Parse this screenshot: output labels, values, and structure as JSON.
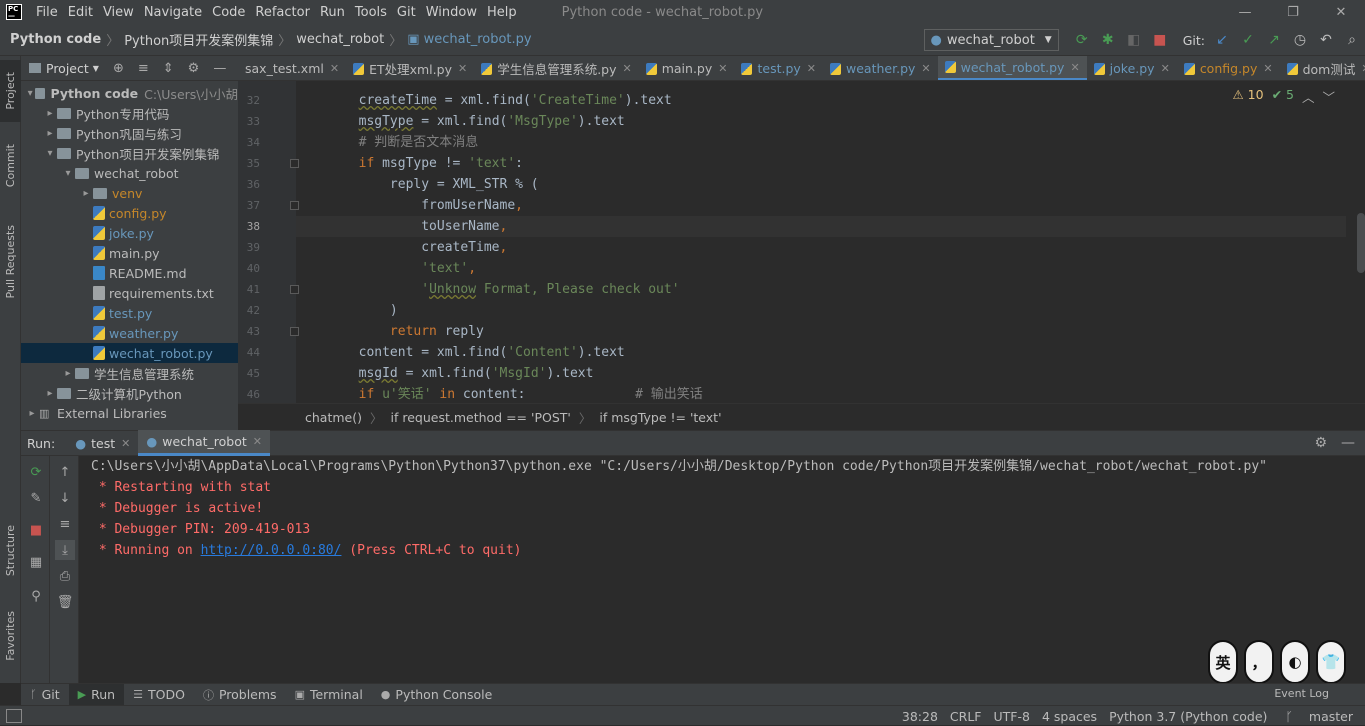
{
  "titlebar": {
    "menu": [
      "File",
      "Edit",
      "View",
      "Navigate",
      "Code",
      "Refactor",
      "Run",
      "Tools",
      "Git",
      "Window",
      "Help"
    ],
    "title": "Python code - wechat_robot.py"
  },
  "navbar": {
    "crumbs": [
      "Python code",
      "Python项目开发案例集锦",
      "wechat_robot",
      "wechat_robot.py"
    ],
    "run_config": "wechat_robot",
    "git_label": "Git:"
  },
  "sidebar_tabs": {
    "project": "Project",
    "commit": "Commit",
    "pull_requests": "Pull Requests",
    "structure": "Structure",
    "favorites": "Favorites"
  },
  "project_panel": {
    "title": "Project",
    "tree": [
      {
        "label": "Python code",
        "extra": "C:\\Users\\小小胡",
        "depth": 0,
        "type": "folder",
        "open": true,
        "bold": true
      },
      {
        "label": "Python专用代码",
        "depth": 1,
        "type": "folder",
        "open": false
      },
      {
        "label": "Python巩固与练习",
        "depth": 1,
        "type": "folder",
        "open": false
      },
      {
        "label": "Python项目开发案例集锦",
        "depth": 1,
        "type": "folder",
        "open": true
      },
      {
        "label": "wechat_robot",
        "depth": 2,
        "type": "folder",
        "open": true
      },
      {
        "label": "venv",
        "depth": 3,
        "type": "folder",
        "open": false,
        "color": "orange"
      },
      {
        "label": "config.py",
        "depth": 3,
        "type": "py",
        "color": "orange"
      },
      {
        "label": "joke.py",
        "depth": 3,
        "type": "py",
        "color": "blue"
      },
      {
        "label": "main.py",
        "depth": 3,
        "type": "py"
      },
      {
        "label": "README.md",
        "depth": 3,
        "type": "md"
      },
      {
        "label": "requirements.txt",
        "depth": 3,
        "type": "txt"
      },
      {
        "label": "test.py",
        "depth": 3,
        "type": "py",
        "color": "blue"
      },
      {
        "label": "weather.py",
        "depth": 3,
        "type": "py",
        "color": "blue"
      },
      {
        "label": "wechat_robot.py",
        "depth": 3,
        "type": "py",
        "color": "blue",
        "selected": true
      },
      {
        "label": "学生信息管理系统",
        "depth": 2,
        "type": "folder",
        "open": false
      },
      {
        "label": "二级计算机Python",
        "depth": 1,
        "type": "folder",
        "open": false
      },
      {
        "label": "External Libraries",
        "depth": 0,
        "type": "lib",
        "open": false
      }
    ]
  },
  "editor_tabs": [
    {
      "label": "sax_test.xml",
      "color": "#bbbbbb"
    },
    {
      "label": "ET处理xml.py",
      "color": "#bbbbbb"
    },
    {
      "label": "学生信息管理系统.py",
      "color": "#bbbbbb"
    },
    {
      "label": "main.py",
      "color": "#bbbbbb"
    },
    {
      "label": "test.py",
      "color": "#6897bb"
    },
    {
      "label": "weather.py",
      "color": "#6897bb"
    },
    {
      "label": "wechat_robot.py",
      "color": "#6897bb",
      "active": true
    },
    {
      "label": "joke.py",
      "color": "#6897bb"
    },
    {
      "label": "config.py",
      "color": "#c5872a"
    },
    {
      "label": "dom测试",
      "color": "#bbbbbb"
    }
  ],
  "inspection": {
    "warnings": "10",
    "ok": "5"
  },
  "code": {
    "current_line": 38,
    "lines": [
      {
        "n": "32",
        "segs": [
          [
            "pl",
            "        "
          ],
          [
            "pl ul",
            "createTime"
          ],
          [
            "pl",
            " = xml.find("
          ],
          [
            "st",
            "'CreateTime'"
          ],
          [
            "pl",
            ").text"
          ]
        ]
      },
      {
        "n": "33",
        "segs": [
          [
            "pl",
            "        "
          ],
          [
            "pl ul",
            "msgType"
          ],
          [
            "pl",
            " = xml.find("
          ],
          [
            "st",
            "'MsgType'"
          ],
          [
            "pl",
            ").text"
          ]
        ]
      },
      {
        "n": "34",
        "segs": [
          [
            "cm",
            "        # 判断是否文本消息"
          ]
        ]
      },
      {
        "n": "35",
        "segs": [
          [
            "kw",
            "        if "
          ],
          [
            "pl",
            "msgType != "
          ],
          [
            "st",
            "'text'"
          ],
          [
            "pl",
            ":"
          ]
        ]
      },
      {
        "n": "36",
        "segs": [
          [
            "pl",
            "            reply = XML_STR % ("
          ]
        ]
      },
      {
        "n": "37",
        "segs": [
          [
            "pl",
            "                fromUserName"
          ],
          [
            "kw",
            ","
          ]
        ]
      },
      {
        "n": "38",
        "segs": [
          [
            "pl",
            "                toUserName"
          ],
          [
            "kw",
            ","
          ]
        ]
      },
      {
        "n": "39",
        "segs": [
          [
            "pl",
            "                createTime"
          ],
          [
            "kw",
            ","
          ]
        ]
      },
      {
        "n": "40",
        "segs": [
          [
            "st",
            "                'text'"
          ],
          [
            "kw",
            ","
          ]
        ]
      },
      {
        "n": "41",
        "segs": [
          [
            "st",
            "                '"
          ],
          [
            "st ul",
            "Unknow"
          ],
          [
            "st",
            " Format, Please check out'"
          ]
        ]
      },
      {
        "n": "42",
        "segs": [
          [
            "pl",
            "            )"
          ]
        ]
      },
      {
        "n": "43",
        "segs": [
          [
            "kw",
            "            return "
          ],
          [
            "pl",
            "reply"
          ]
        ]
      },
      {
        "n": "44",
        "segs": [
          [
            "pl",
            "        content = xml.find("
          ],
          [
            "st",
            "'Content'"
          ],
          [
            "pl",
            ").text"
          ]
        ]
      },
      {
        "n": "45",
        "segs": [
          [
            "pl",
            "        "
          ],
          [
            "pl ul",
            "msgId"
          ],
          [
            "pl",
            " = xml.find("
          ],
          [
            "st",
            "'MsgId'"
          ],
          [
            "pl",
            ").text"
          ]
        ]
      },
      {
        "n": "46",
        "segs": [
          [
            "kw",
            "        if "
          ],
          [
            "st",
            "u'笑话'"
          ],
          [
            "kw",
            " in "
          ],
          [
            "pl",
            "content:"
          ],
          [
            "cm",
            "              # 输出笑话"
          ]
        ]
      }
    ]
  },
  "editor_breadcrumb": [
    "chatme()",
    "if request.method == 'POST'",
    "if msgType != 'text'"
  ],
  "run": {
    "label": "Run:",
    "tabs": [
      {
        "label": "test"
      },
      {
        "label": "wechat_robot",
        "active": true
      }
    ],
    "console": [
      {
        "type": "cmd",
        "text": "C:\\Users\\小小胡\\AppData\\Local\\Programs\\Python\\Python37\\python.exe \"C:/Users/小小胡/Desktop/Python code/Python项目开发案例集锦/wechat_robot/wechat_robot.py\""
      },
      {
        "type": "err",
        "text": " * Restarting with stat"
      },
      {
        "type": "err",
        "text": " * Debugger is active!"
      },
      {
        "type": "err",
        "text": " * Debugger PIN: 209-419-013"
      },
      {
        "type": "err",
        "pre": " * Running on ",
        "link": "http://0.0.0.0:80/",
        "post": " (Press CTRL+C to quit)"
      }
    ]
  },
  "toolwindows": [
    {
      "label": "Git",
      "icon": "git-icon"
    },
    {
      "label": "Run",
      "icon": "play-icon",
      "active": true
    },
    {
      "label": "TODO",
      "icon": "list-icon"
    },
    {
      "label": "Problems",
      "icon": "info-icon"
    },
    {
      "label": "Terminal",
      "icon": "terminal-icon"
    },
    {
      "label": "Python Console",
      "icon": "python-icon"
    }
  ],
  "event_log": "Event Log",
  "stickers": [
    "英",
    "，",
    "◐",
    "👕"
  ],
  "status": {
    "position": "38:28",
    "line_sep": "CRLF",
    "encoding": "UTF-8",
    "indent": "4 spaces",
    "interpreter": "Python 3.7 (Python code)",
    "branch": "master"
  },
  "colors": {
    "accent": "#4a88c7",
    "bg": "#2b2b2b",
    "panel": "#3c3f41",
    "error": "#ff6b68",
    "link": "#287bde"
  }
}
